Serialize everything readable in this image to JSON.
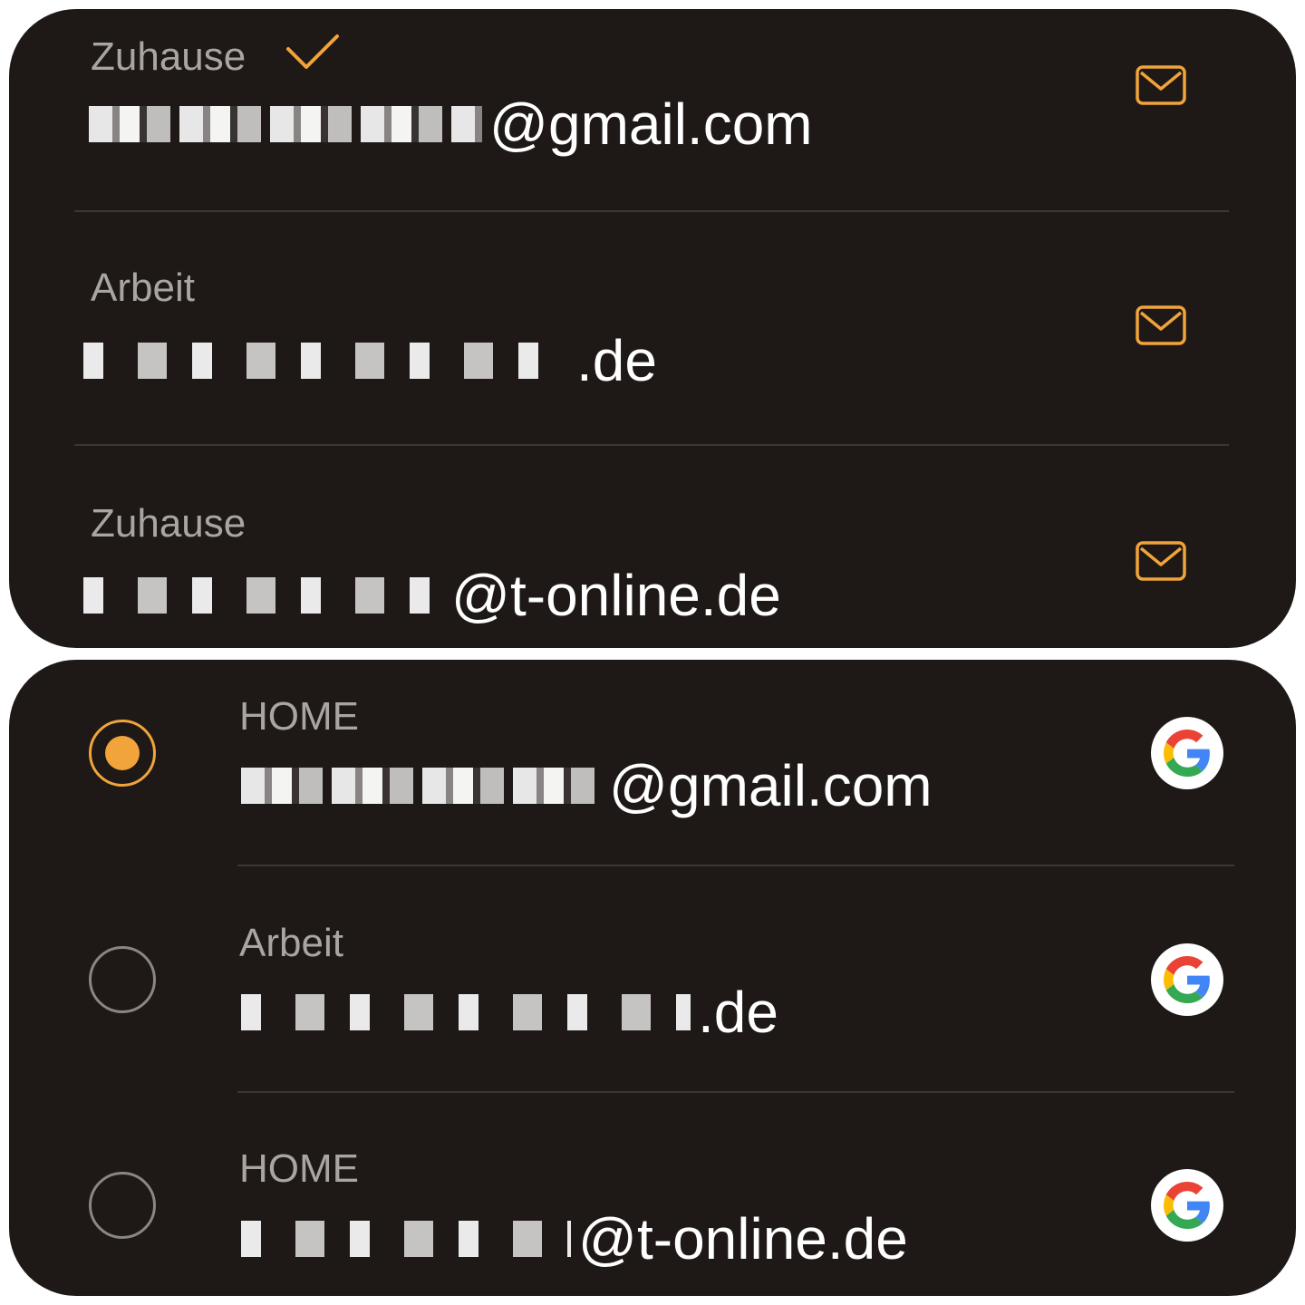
{
  "colors": {
    "panel_bg": "#1e1917",
    "label_text": "#a9a5a3",
    "email_text": "#ffffff",
    "accent": "#f0a43a",
    "divider": "#3c3634"
  },
  "top_list": {
    "items": [
      {
        "label": "Zuhause",
        "email_suffix": "@gmail.com",
        "default": true,
        "icon": "mail-icon"
      },
      {
        "label": "Arbeit",
        "email_suffix": ".de",
        "default": false,
        "icon": "mail-icon"
      },
      {
        "label": "Zuhause",
        "email_suffix": "@t-online.de",
        "default": false,
        "icon": "mail-icon"
      }
    ]
  },
  "bottom_list": {
    "items": [
      {
        "label": "HOME",
        "email_suffix": "@gmail.com",
        "selected": true,
        "icon": "google-icon"
      },
      {
        "label": "Arbeit",
        "email_suffix": ".de",
        "selected": false,
        "icon": "google-icon"
      },
      {
        "label": "HOME",
        "email_suffix": "@t-online.de",
        "selected": false,
        "icon": "google-icon"
      }
    ]
  }
}
